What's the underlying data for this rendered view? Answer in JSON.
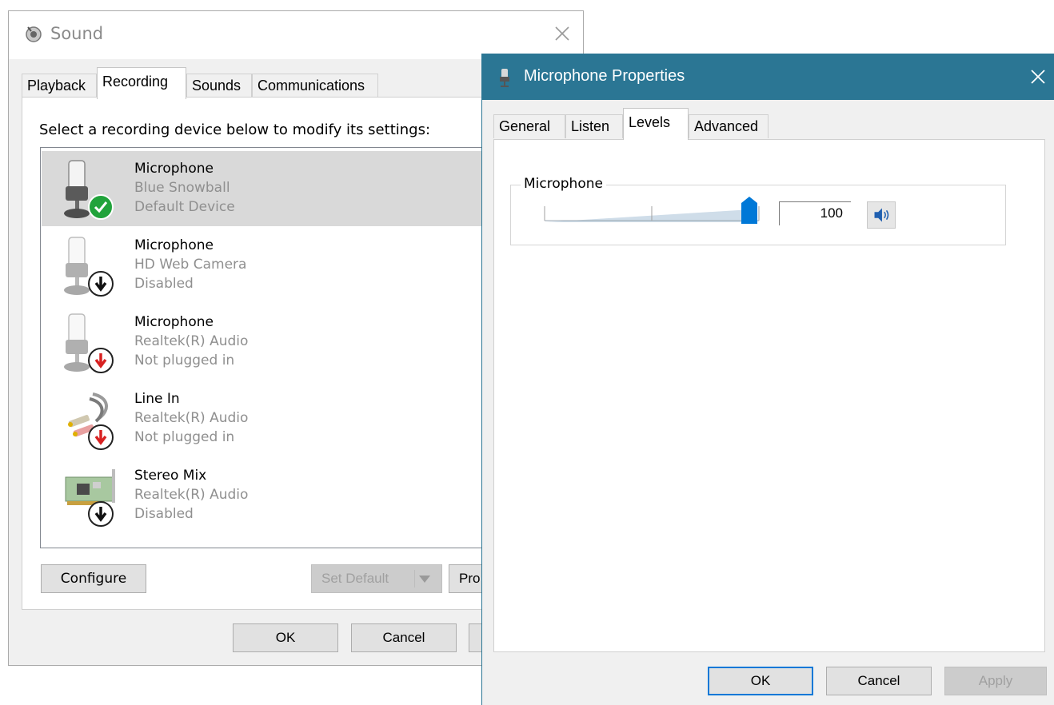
{
  "sound": {
    "title": "Sound",
    "tabs": [
      "Playback",
      "Recording",
      "Sounds",
      "Communications"
    ],
    "active_tab": "Recording",
    "instruction": "Select a recording device below to modify its settings:",
    "devices": [
      {
        "name": "Microphone",
        "sub": "Blue Snowball",
        "status": "Default Device",
        "icon": "microphone-icon",
        "badge": "green-check-icon",
        "selected": true
      },
      {
        "name": "Microphone",
        "sub": "HD Web Camera",
        "status": "Disabled",
        "icon": "microphone-icon",
        "badge": "black-down-arrow-icon",
        "selected": false
      },
      {
        "name": "Microphone",
        "sub": "Realtek(R) Audio",
        "status": "Not plugged in",
        "icon": "microphone-icon",
        "badge": "red-down-arrow-icon",
        "selected": false
      },
      {
        "name": "Line In",
        "sub": "Realtek(R) Audio",
        "status": "Not plugged in",
        "icon": "rca-cable-icon",
        "badge": "red-down-arrow-icon",
        "selected": false
      },
      {
        "name": "Stereo Mix",
        "sub": "Realtek(R) Audio",
        "status": "Disabled",
        "icon": "sound-card-icon",
        "badge": "black-down-arrow-icon",
        "selected": false
      }
    ],
    "buttons": {
      "configure": "Configure",
      "set_default": "Set Default",
      "properties": "Pro",
      "ok": "OK",
      "cancel": "Cancel",
      "apply": ""
    }
  },
  "mic_props": {
    "title": "Microphone Properties",
    "tabs": [
      "General",
      "Listen",
      "Levels",
      "Advanced"
    ],
    "active_tab": "Levels",
    "group_label": "Microphone",
    "level_value": "100",
    "level_fraction": 1.0,
    "buttons": {
      "ok": "OK",
      "cancel": "Cancel",
      "apply": "Apply"
    }
  },
  "colors": {
    "accent": "#0078d7",
    "mic_titlebar": "#2b7694",
    "selected_row": "#d9d9d9",
    "check_green": "#21a33b",
    "arrow_red": "#d82222"
  }
}
